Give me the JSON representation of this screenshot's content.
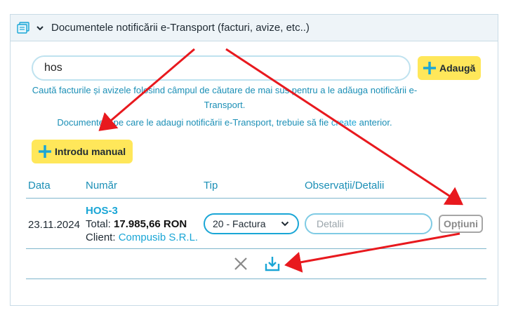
{
  "panel": {
    "title": "Documentele notificării e-Transport (facturi, avize, etc..)",
    "header_icon": "document-stack-icon",
    "toggle_icon": "chevron-down-icon"
  },
  "search": {
    "value": "hos",
    "add_button_label": "Adaugă"
  },
  "hints": {
    "line1": "Caută facturile și avizele folosind câmpul de căutare de mai sus pentru a le adăuga notificării e-Transport.",
    "line2_prefix": "Documentele pe care le adaugi notificării e-Transport, trebuie să fie ",
    "line2_link": "create",
    "line2_suffix": " anterior."
  },
  "manual_button_label": "Introdu manual",
  "table": {
    "headers": {
      "date": "Data",
      "number": "Număr",
      "type": "Tip",
      "notes": "Observații/Detalii"
    },
    "rows": [
      {
        "date": "23.11.2024",
        "doc_number": "HOS-3",
        "total_label": "Total:",
        "total_value": "17.985,66 RON",
        "client_label": "Client:",
        "client_name": "Compusib S.R.L.",
        "type_selected": "20 - Factura",
        "details_placeholder": "Detalii",
        "options_label": "Opțiuni"
      }
    ]
  },
  "actions": {
    "remove_icon": "close-icon",
    "download_icon": "download-icon"
  },
  "colors": {
    "accent": "#1aa6d6",
    "button_yellow": "#ffe75a",
    "annotation_arrow": "#e8191e"
  }
}
